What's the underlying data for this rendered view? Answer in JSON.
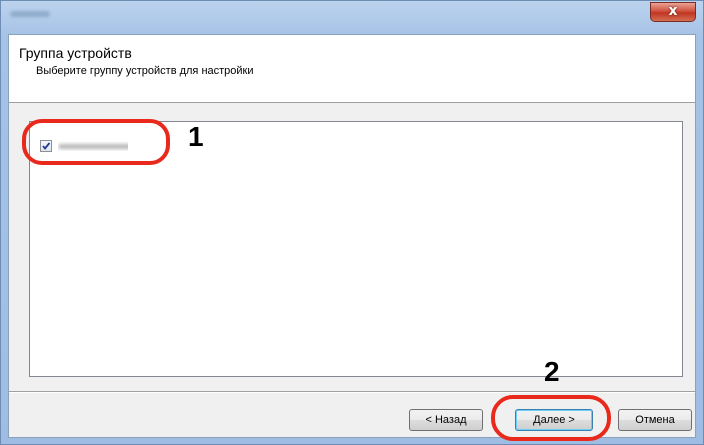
{
  "window": {
    "close_glyph": "x"
  },
  "header": {
    "title": "Группа устройств",
    "subtitle": "Выберите группу устройств для настройки"
  },
  "list": {
    "items": [
      {
        "checked": true
      }
    ]
  },
  "callouts": {
    "first": "1",
    "second": "2",
    "color": "#e8291c"
  },
  "buttons": {
    "back": "< Назад",
    "next": "Далее >",
    "cancel": "Отмена"
  }
}
